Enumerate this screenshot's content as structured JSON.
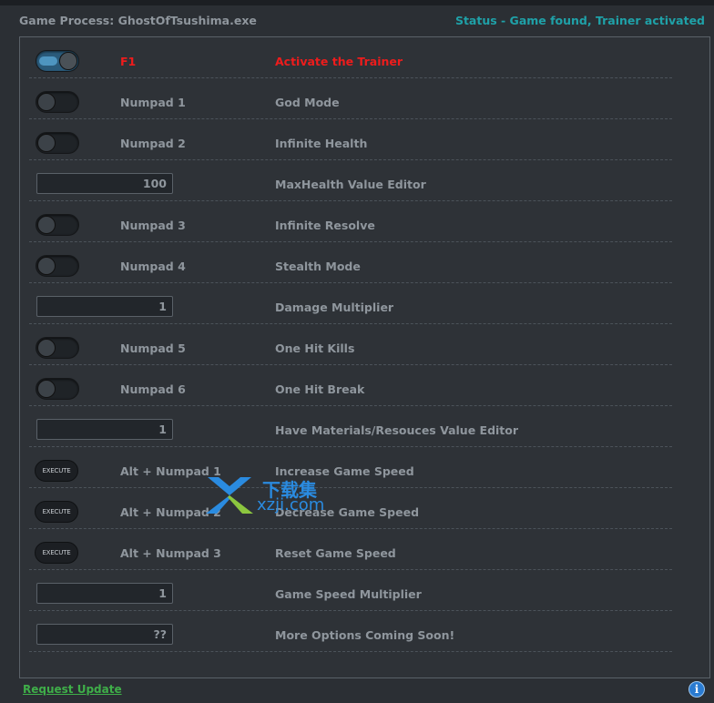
{
  "header": {
    "process_label": "Game Process: GhostOfTsushima.exe",
    "status": "Status - Game found, Trainer activated"
  },
  "colors": {
    "accent_teal": "#1fa1a8",
    "activate_red": "#ee1c1c",
    "link_green": "#3fae49"
  },
  "rows": [
    {
      "control": "toggle",
      "state": "on",
      "hotkey": "F1",
      "label": "Activate the Trainer"
    },
    {
      "control": "toggle",
      "state": "off",
      "hotkey": "Numpad 1",
      "label": "God Mode"
    },
    {
      "control": "toggle",
      "state": "off",
      "hotkey": "Numpad 2",
      "label": "Infinite Health"
    },
    {
      "control": "value",
      "value": "100",
      "label": "MaxHealth Value Editor"
    },
    {
      "control": "toggle",
      "state": "off",
      "hotkey": "Numpad 3",
      "label": "Infinite Resolve"
    },
    {
      "control": "toggle",
      "state": "off",
      "hotkey": "Numpad 4",
      "label": "Stealth Mode"
    },
    {
      "control": "value",
      "value": "1",
      "label": "Damage Multiplier"
    },
    {
      "control": "toggle",
      "state": "off",
      "hotkey": "Numpad 5",
      "label": "One Hit Kills"
    },
    {
      "control": "toggle",
      "state": "off",
      "hotkey": "Numpad 6",
      "label": "One Hit Break"
    },
    {
      "control": "value",
      "value": "1",
      "label": "Have Materials/Resouces Value Editor"
    },
    {
      "control": "execute",
      "button": "EXECUTE",
      "hotkey": "Alt + Numpad 1",
      "label": "Increase Game Speed"
    },
    {
      "control": "execute",
      "button": "EXECUTE",
      "hotkey": "Alt + Numpad 2",
      "label": "Decrease Game Speed"
    },
    {
      "control": "execute",
      "button": "EXECUTE",
      "hotkey": "Alt + Numpad 3",
      "label": "Reset Game Speed"
    },
    {
      "control": "value",
      "value": "1",
      "label": "Game Speed Multiplier"
    },
    {
      "control": "value",
      "value": "??",
      "label": "More Options Coming Soon!"
    }
  ],
  "footer": {
    "request_update": "Request Update",
    "info_icon": "info-icon"
  },
  "watermark": {
    "cn_text": "下载集",
    "url": "xzji.com",
    "icon": "xzji-logo-icon"
  }
}
